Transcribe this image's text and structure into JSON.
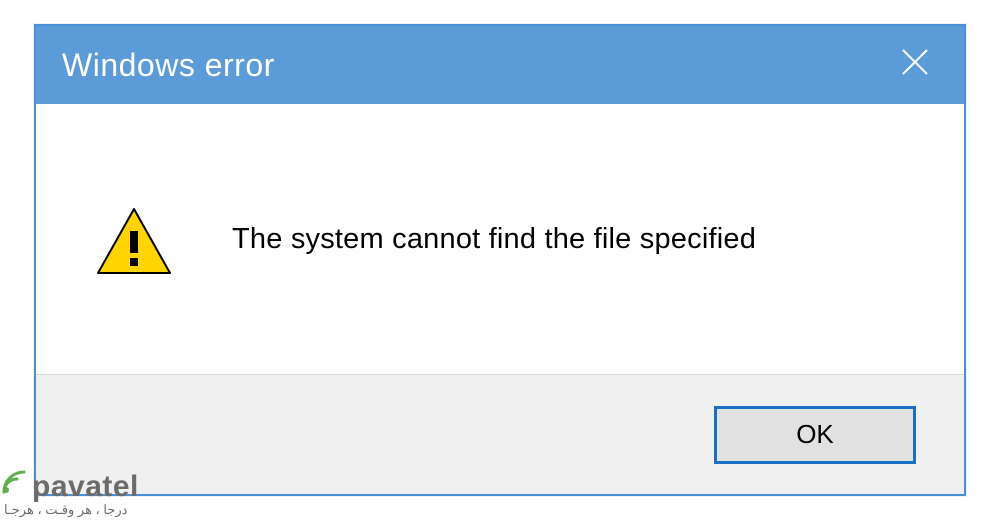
{
  "dialog": {
    "title": "Windows error",
    "message": "The system cannot find the file specified",
    "ok_label": "OK"
  },
  "watermark": {
    "brand": "pavatel",
    "tagline": "درجا ، هر وقـت ، هرجـا"
  },
  "colors": {
    "titlebar": "#5a9bd8",
    "border": "#4a90d9",
    "footer": "#f0f0f0",
    "button_border": "#1a6fc4",
    "warn_fill": "#ffd400",
    "warn_stroke": "#000000",
    "watermark_accent": "#5fb04e"
  }
}
